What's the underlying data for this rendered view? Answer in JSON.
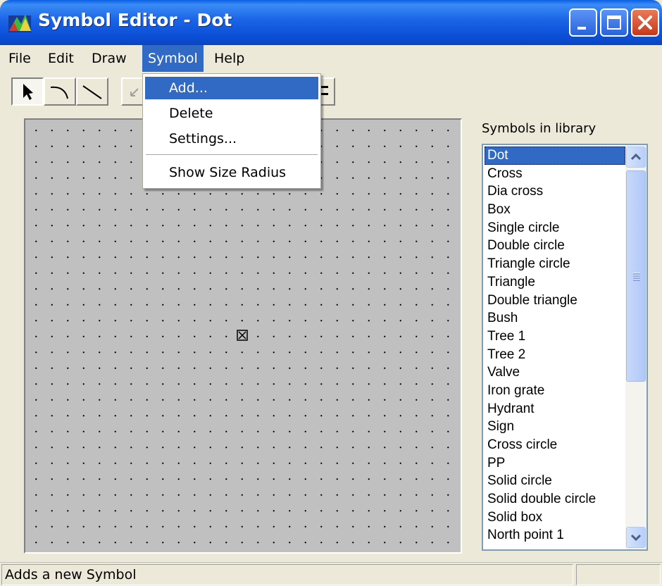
{
  "window": {
    "title": "Symbol Editor - Dot"
  },
  "menubar": {
    "items": [
      "File",
      "Edit",
      "Draw",
      "Symbol",
      "Help"
    ],
    "active": "Symbol"
  },
  "toolbar": {
    "tools": [
      "pointer-tool",
      "arc-tool",
      "line-tool",
      "undo-tool"
    ]
  },
  "symbol_menu": {
    "items": [
      "Add...",
      "Delete",
      "Settings..."
    ],
    "extra_items": [
      "Show Size Radius"
    ],
    "highlighted": "Add..."
  },
  "panel": {
    "label": "Symbols in library",
    "symbols": [
      "Dot",
      "Cross",
      "Dia cross",
      "Box",
      "Single circle",
      "Double circle",
      "Triangle circle",
      "Triangle",
      "Double triangle",
      "Bush",
      "Tree 1",
      "Tree 2",
      "Valve",
      "Iron grate",
      "Hydrant",
      "Sign",
      "Cross circle",
      "PP",
      "Solid circle",
      "Solid double circle",
      "Solid box",
      "North point 1"
    ],
    "selected": "Dot"
  },
  "status": {
    "text": "Adds a new Symbol"
  },
  "colors": {
    "titlebar": "#0b4fd7",
    "selection": "#316ac5",
    "canvas": "#c0c0c0",
    "chrome": "#ece9d8"
  },
  "icons": [
    "app-icon",
    "minimize-icon",
    "maximize-icon",
    "close-icon",
    "pointer-arrow-icon",
    "arc-icon",
    "line-icon",
    "undo-icon",
    "center-marker-icon",
    "scroll-up-icon",
    "scroll-down-icon"
  ]
}
